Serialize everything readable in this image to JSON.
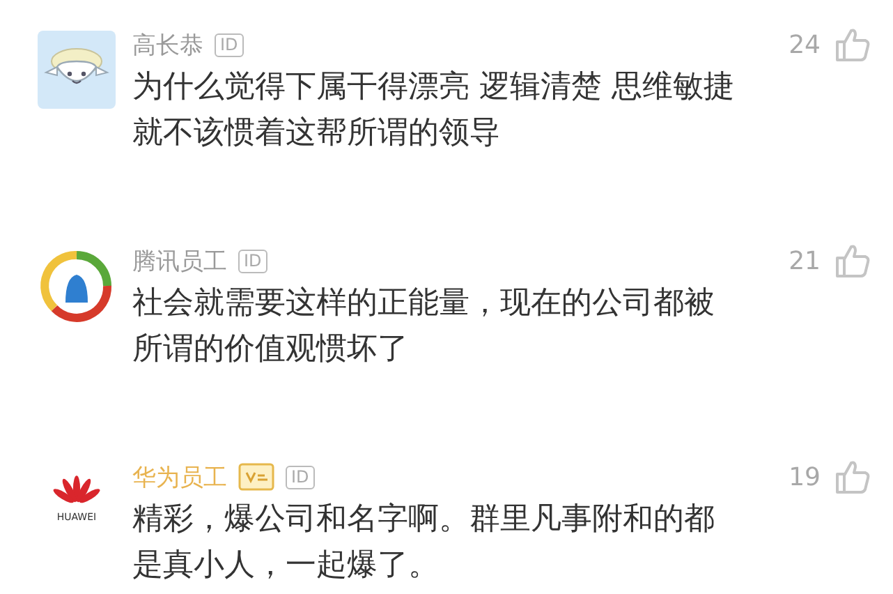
{
  "comments": [
    {
      "avatar": {
        "kind": "sheep"
      },
      "name": "高长恭",
      "vip": false,
      "id_badge": "ID",
      "likes": "24",
      "lines": [
        "为什么觉得下属干得漂亮 逻辑清楚 思维敏捷",
        "就不该惯着这帮所谓的领导"
      ]
    },
    {
      "avatar": {
        "kind": "ring"
      },
      "name": "腾讯员工",
      "vip": false,
      "id_badge": "ID",
      "likes": "21",
      "lines": [
        "社会就需要这样的正能量，现在的公司都被",
        "所谓的价值观惯坏了"
      ]
    },
    {
      "avatar": {
        "kind": "petals",
        "logo_text": "HUAWEI"
      },
      "name": "华为员工",
      "vip": true,
      "id_badge": "ID",
      "likes": "19",
      "lines": [
        "精彩，爆公司和名字啊。群里凡事附和的都",
        "是真小人，一起爆了。"
      ]
    }
  ]
}
